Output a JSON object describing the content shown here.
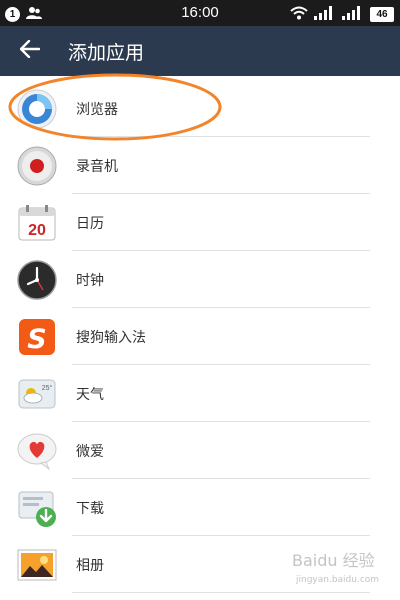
{
  "status_bar": {
    "notification_count": "1",
    "time": "16:00",
    "battery": "46",
    "icons": [
      "notification-badge-icon",
      "contacts-icon",
      "wifi-icon",
      "signal-icon",
      "signal-icon",
      "battery-icon"
    ]
  },
  "header": {
    "back_icon": "arrow-left-icon",
    "title": "添加应用"
  },
  "apps": [
    {
      "label": "浏览器",
      "icon": "browser-icon"
    },
    {
      "label": "录音机",
      "icon": "recorder-icon"
    },
    {
      "label": "日历",
      "icon": "calendar-icon",
      "icon_text": "20"
    },
    {
      "label": "时钟",
      "icon": "clock-icon"
    },
    {
      "label": "搜狗输入法",
      "icon": "sogou-input-icon",
      "icon_text": "S"
    },
    {
      "label": "天气",
      "icon": "weather-icon",
      "icon_text": "25°"
    },
    {
      "label": "微爱",
      "icon": "heart-icon"
    },
    {
      "label": "下载",
      "icon": "download-icon"
    },
    {
      "label": "相册",
      "icon": "gallery-icon"
    }
  ],
  "colors": {
    "app_bar": "#2c3a4f",
    "status_bar": "#1b1b1b",
    "highlight": "#f2852b",
    "divider": "#e1e1e1"
  }
}
